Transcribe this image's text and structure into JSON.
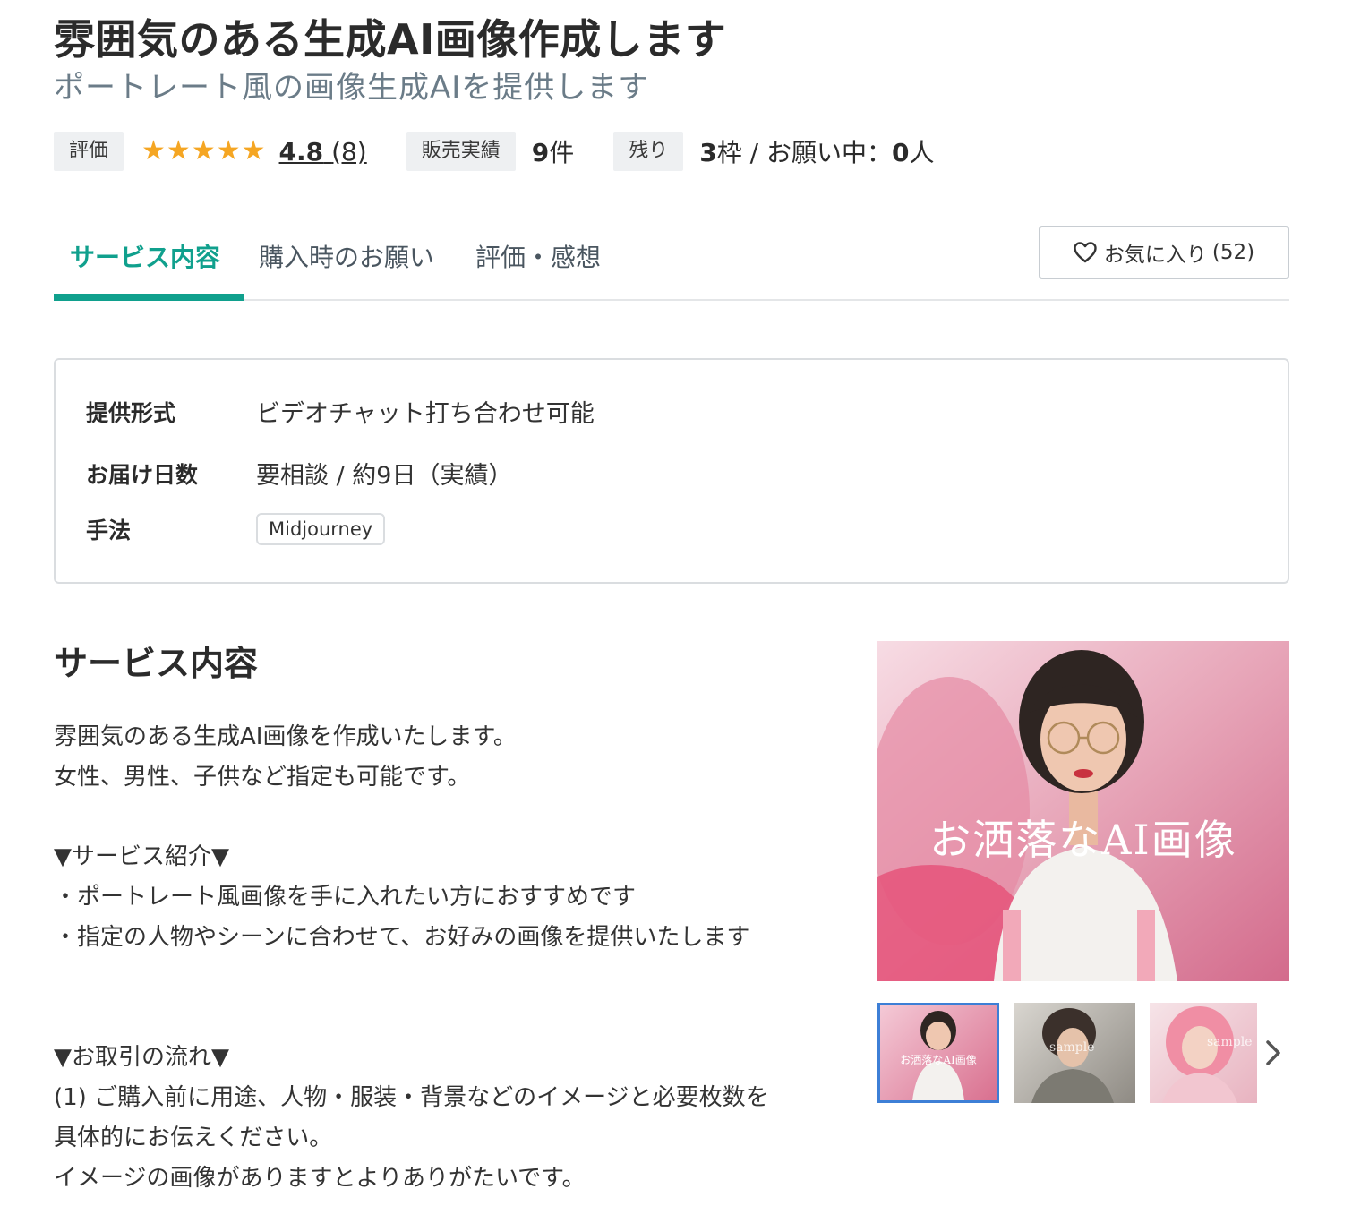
{
  "header": {
    "title": "雰囲気のある生成AI画像作成します",
    "subtitle": "ポートレート風の画像生成AIを提供します"
  },
  "stats": {
    "rating_label": "評価",
    "rating_score": "4.8",
    "rating_count": "(8)",
    "stars": 5,
    "sales_label": "販売実績",
    "sales_value": "9",
    "sales_unit": "件",
    "remaining_label": "残り",
    "remaining_value": "3",
    "remaining_unit": "枠",
    "requesting_text": "/ お願い中：",
    "requesting_value": "0",
    "requesting_unit": "人",
    "star_color": "#f5a623"
  },
  "tabs": [
    {
      "label": "サービス内容",
      "active": true
    },
    {
      "label": "購入時のお願い",
      "active": false
    },
    {
      "label": "評価・感想",
      "active": false
    }
  ],
  "favorite": {
    "label": "お気に入り",
    "count": "(52)",
    "icon": "heart-icon"
  },
  "info": {
    "format_label": "提供形式",
    "format_value": "ビデオチャット打ち合わせ可能",
    "delivery_label": "お届け日数",
    "delivery_value": "要相談 / 約9日（実績）",
    "method_label": "手法",
    "method_tag": "Midjourney"
  },
  "service": {
    "section_title": "サービス内容",
    "lines": [
      "雰囲気のある生成AI画像を作成いたします。",
      "女性、男性、子供など指定も可能です。",
      "",
      "▼サービス紹介▼",
      "・ポートレート風画像を手に入れたい方におすすめです",
      "・指定の人物やシーンに合わせて、お好みの画像を提供いたします",
      "",
      "",
      "▼お取引の流れ▼",
      "(1) ご購入前に用途、人物・服装・背景などのイメージと必要枚数を",
      "具体的にお伝えください。",
      "イメージの画像がありますとよりありがたいです。"
    ]
  },
  "gallery": {
    "main_caption": "お洒落なAI画像",
    "thumbs": [
      {
        "caption": "お洒落なAI画像",
        "selected": true
      },
      {
        "caption": "sample",
        "selected": false
      },
      {
        "caption": "sample",
        "selected": false
      }
    ],
    "accent_color": "#3d7fd6"
  },
  "colors": {
    "accent": "#10a08d",
    "subtitle": "#6b7c88"
  }
}
